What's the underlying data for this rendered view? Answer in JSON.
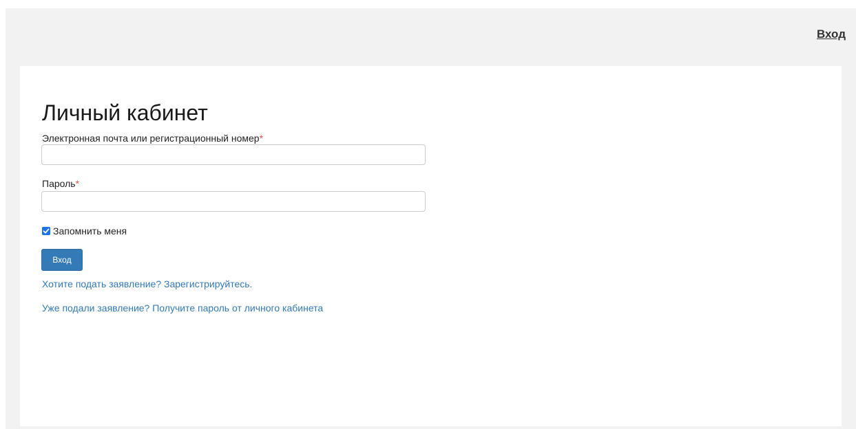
{
  "header": {
    "login_link": "Вход"
  },
  "main": {
    "title": "Личный кабинет",
    "email_label": "Электронная почта или регистрационный номер",
    "email_required_mark": "*",
    "email_value": "",
    "password_label": "Пароль",
    "password_required_mark": "*",
    "password_value": "",
    "remember_label": "Запомнить меня",
    "remember_checked": true,
    "submit_label": "Вход",
    "register_link": "Хотите подать заявление? Зарегистрируйтесь.",
    "get_password_link": "Уже подали заявление? Получите пароль от личного кабинета"
  },
  "colors": {
    "accent": "#337ab7",
    "required": "#d9534f",
    "header_bg": "#f2f2f2",
    "checkbox": "#1a73e8"
  }
}
